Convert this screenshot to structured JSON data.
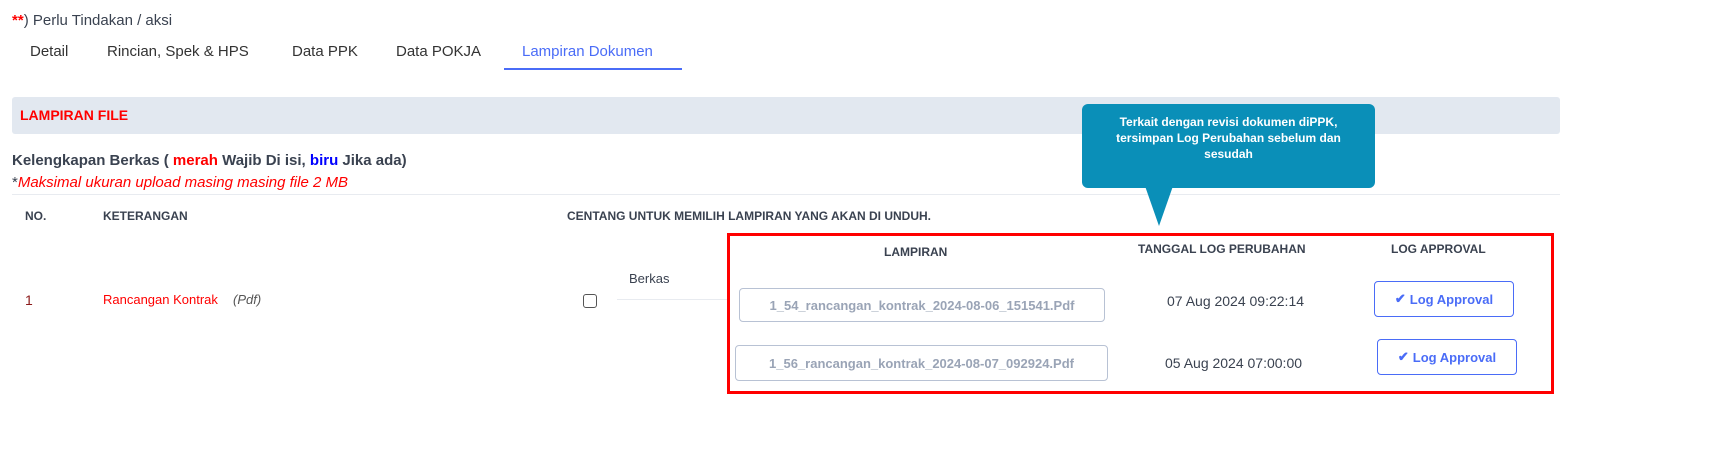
{
  "note": {
    "stars": "**",
    "text": ") Perlu Tindakan / aksi"
  },
  "tabs": [
    {
      "label": "Detail"
    },
    {
      "label": "Rincian, Spek & HPS"
    },
    {
      "label": "Data PPK"
    },
    {
      "label": "Data POKJA"
    },
    {
      "label": "Lampiran Dokumen",
      "active": true
    }
  ],
  "section": {
    "title": "LAMPIRAN FILE"
  },
  "kelengkapan": {
    "prefix": "Kelengkapan Berkas ( ",
    "merah": "merah",
    "mid": " Wajib Di isi, ",
    "biru": "biru",
    "suffix": " Jika ada)"
  },
  "max_note": {
    "star": "*",
    "text": "Maksimal ukuran upload masing masing file 2 MB"
  },
  "table": {
    "headers": {
      "no": "NO.",
      "keterangan": "KETERANGAN",
      "centang": "CENTANG UNTUK MEMILIH LAMPIRAN YANG AKAN DI UNDUH."
    },
    "row": {
      "no": "1",
      "name": "Rancangan Kontrak",
      "type": "(Pdf)",
      "berkas": "Berkas"
    },
    "sub_headers": {
      "lampiran": "LAMPIRAN",
      "tanggal": "TANGGAL LOG PERUBAHAN",
      "log": "LOG APPROVAL"
    },
    "files": [
      {
        "name": "1_54_rancangan_kontrak_2024-08-06_151541.Pdf",
        "date": "07 Aug 2024 09:22:14",
        "button": "Log Approval"
      },
      {
        "name": "1_56_rancangan_kontrak_2024-08-07_092924.Pdf",
        "date": "05 Aug 2024 07:00:00",
        "button": "Log Approval"
      }
    ]
  },
  "tooltip": {
    "text": "Terkait dengan revisi dokumen diPPK, tersimpan Log Perubahan sebelum dan sesudah"
  }
}
